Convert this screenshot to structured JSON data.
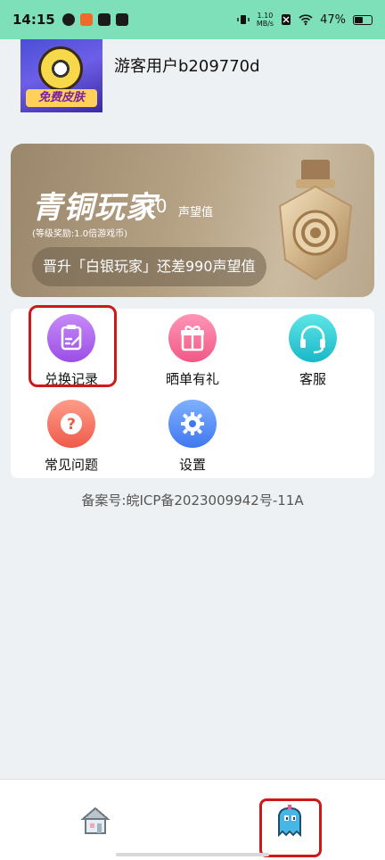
{
  "status_bar": {
    "time": "14:15",
    "net_speed_value": "1.10",
    "net_speed_unit": "MB/s",
    "battery": "47%"
  },
  "profile": {
    "avatar_badge_text": "免费皮肤",
    "username": "游客用户b209770d"
  },
  "level": {
    "title": "青铜玩家",
    "value": "10",
    "unit": "声望值",
    "reward_text": "(等级奖励:1.0倍游戏币)",
    "upgrade_text": "晋升「白银玩家」还差990声望值"
  },
  "menu": {
    "items": [
      {
        "label": "兑换记录",
        "icon": "clipboard-edit-icon",
        "color": "#b06cf0"
      },
      {
        "label": "晒单有礼",
        "icon": "gift-icon",
        "color": "#f4729a"
      },
      {
        "label": "客服",
        "icon": "headset-icon",
        "color": "#2cc6d4"
      },
      {
        "label": "常见问题",
        "icon": "question-icon",
        "color": "#f06e5c"
      },
      {
        "label": "设置",
        "icon": "gear-icon",
        "color": "#4f86f4"
      }
    ]
  },
  "footer": {
    "icp": "备案号:皖ICP备2023009942号-11A"
  },
  "bottom_nav": {
    "items": [
      {
        "name": "home",
        "icon": "pixel-house-icon"
      },
      {
        "name": "mine",
        "icon": "pixel-ghost-icon"
      }
    ]
  },
  "colors": {
    "status_bar": "#7ee0b8",
    "highlight": "#d01818",
    "page_bg": "#eef1f3"
  }
}
